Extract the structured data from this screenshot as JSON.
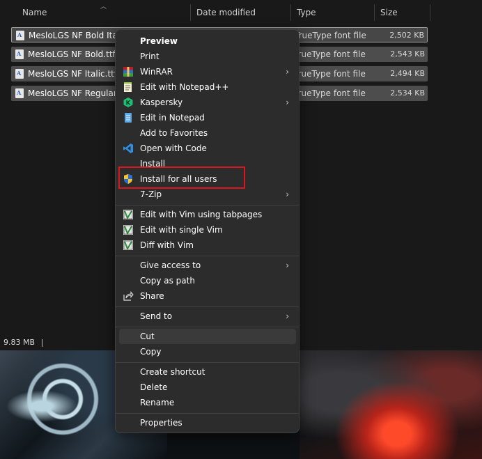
{
  "columns": {
    "name": "Name",
    "date_modified": "Date modified",
    "type": "Type",
    "size": "Size"
  },
  "files": [
    {
      "name": "MesloLGS NF Bold Italic.ttf",
      "type": "TrueType font file",
      "size": "2,502 KB"
    },
    {
      "name": "MesloLGS NF Bold.ttf",
      "type": "TrueType font file",
      "size": "2,543 KB"
    },
    {
      "name": "MesloLGS NF Italic.ttf",
      "type": "TrueType font file",
      "size": "2,494 KB"
    },
    {
      "name": "MesloLGS NF Regular.ttf",
      "type": "TrueType font file",
      "size": "2,534 KB"
    }
  ],
  "status_bar": {
    "selection_size": "9.83 MB"
  },
  "context_menu": {
    "preview": "Preview",
    "print": "Print",
    "winrar": "WinRAR",
    "edit_notepadpp": "Edit with Notepad++",
    "kaspersky": "Kaspersky",
    "edit_notepad": "Edit in Notepad",
    "add_favorites": "Add to Favorites",
    "open_code": "Open with Code",
    "install": "Install",
    "install_all": "Install for all users",
    "seven_zip": "7-Zip",
    "vim_tabs": "Edit with Vim using tabpages",
    "vim_single": "Edit with single Vim",
    "vim_diff": "Diff with Vim",
    "give_access": "Give access to",
    "copy_path": "Copy as path",
    "share": "Share",
    "send_to": "Send to",
    "cut": "Cut",
    "copy": "Copy",
    "create_shortcut": "Create shortcut",
    "delete": "Delete",
    "rename": "Rename",
    "properties": "Properties"
  },
  "colors": {
    "highlight_border": "#e0141b",
    "menu_bg": "#2c2c2c",
    "selection_bg": "#4d4d4d"
  }
}
